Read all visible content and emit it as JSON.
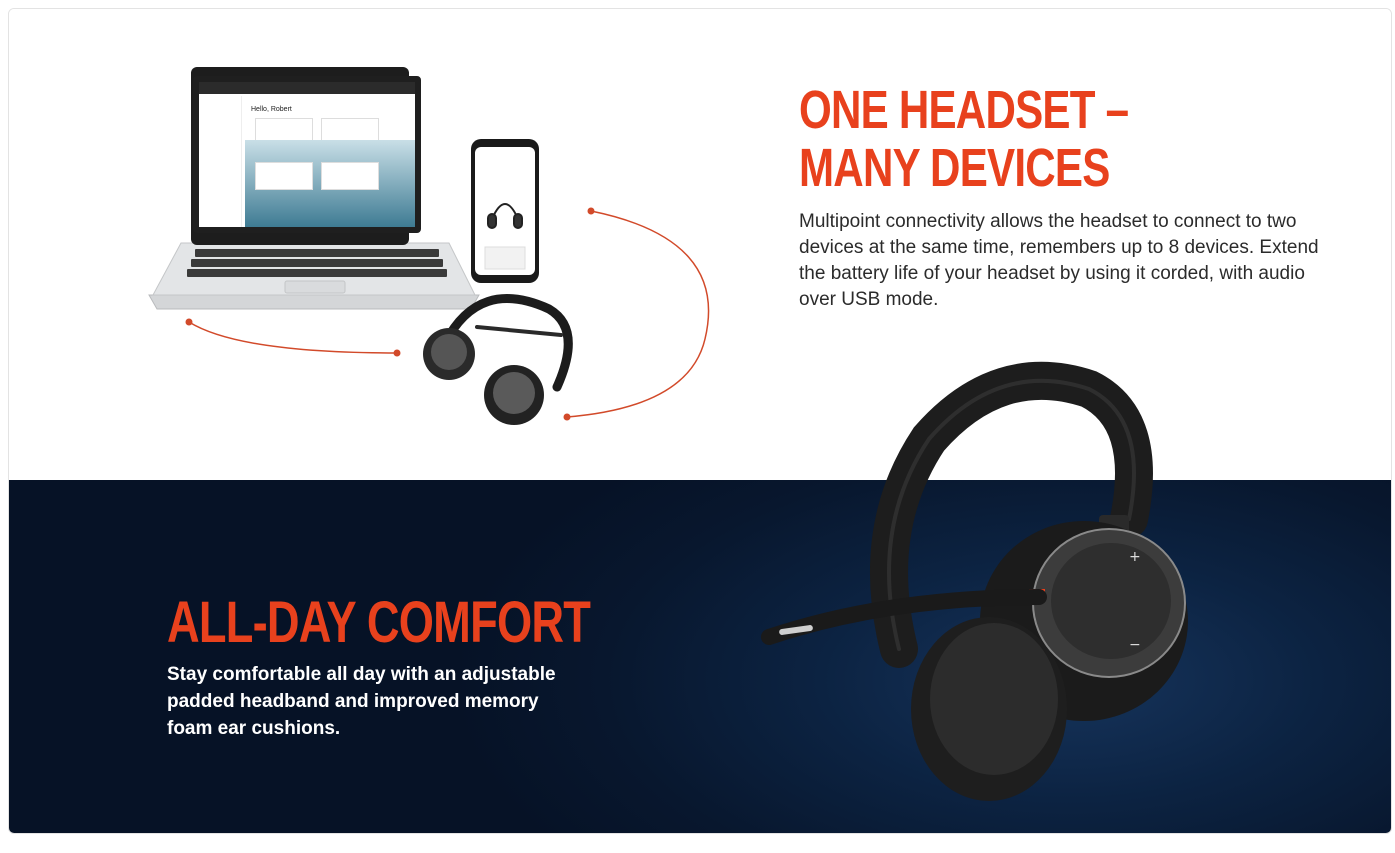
{
  "section_one": {
    "headline_line1": "ONE HEADSET –",
    "headline_line2": "MANY DEVICES",
    "description": "Multipoint connectivity allows the headset to connect to two devices at the same time, remembers up to 8 devices. Extend the battery life of your headset by using it corded, with audio over USB mode."
  },
  "section_two": {
    "headline": "ALL-DAY COMFORT",
    "description": "Stay comfortable all day with an adjustable padded headband and improved memory foam ear cushions."
  },
  "laptop_app": {
    "greeting": "Hello, Robert"
  },
  "colors": {
    "accent": "#e8411d",
    "navy": "#0c2342"
  }
}
